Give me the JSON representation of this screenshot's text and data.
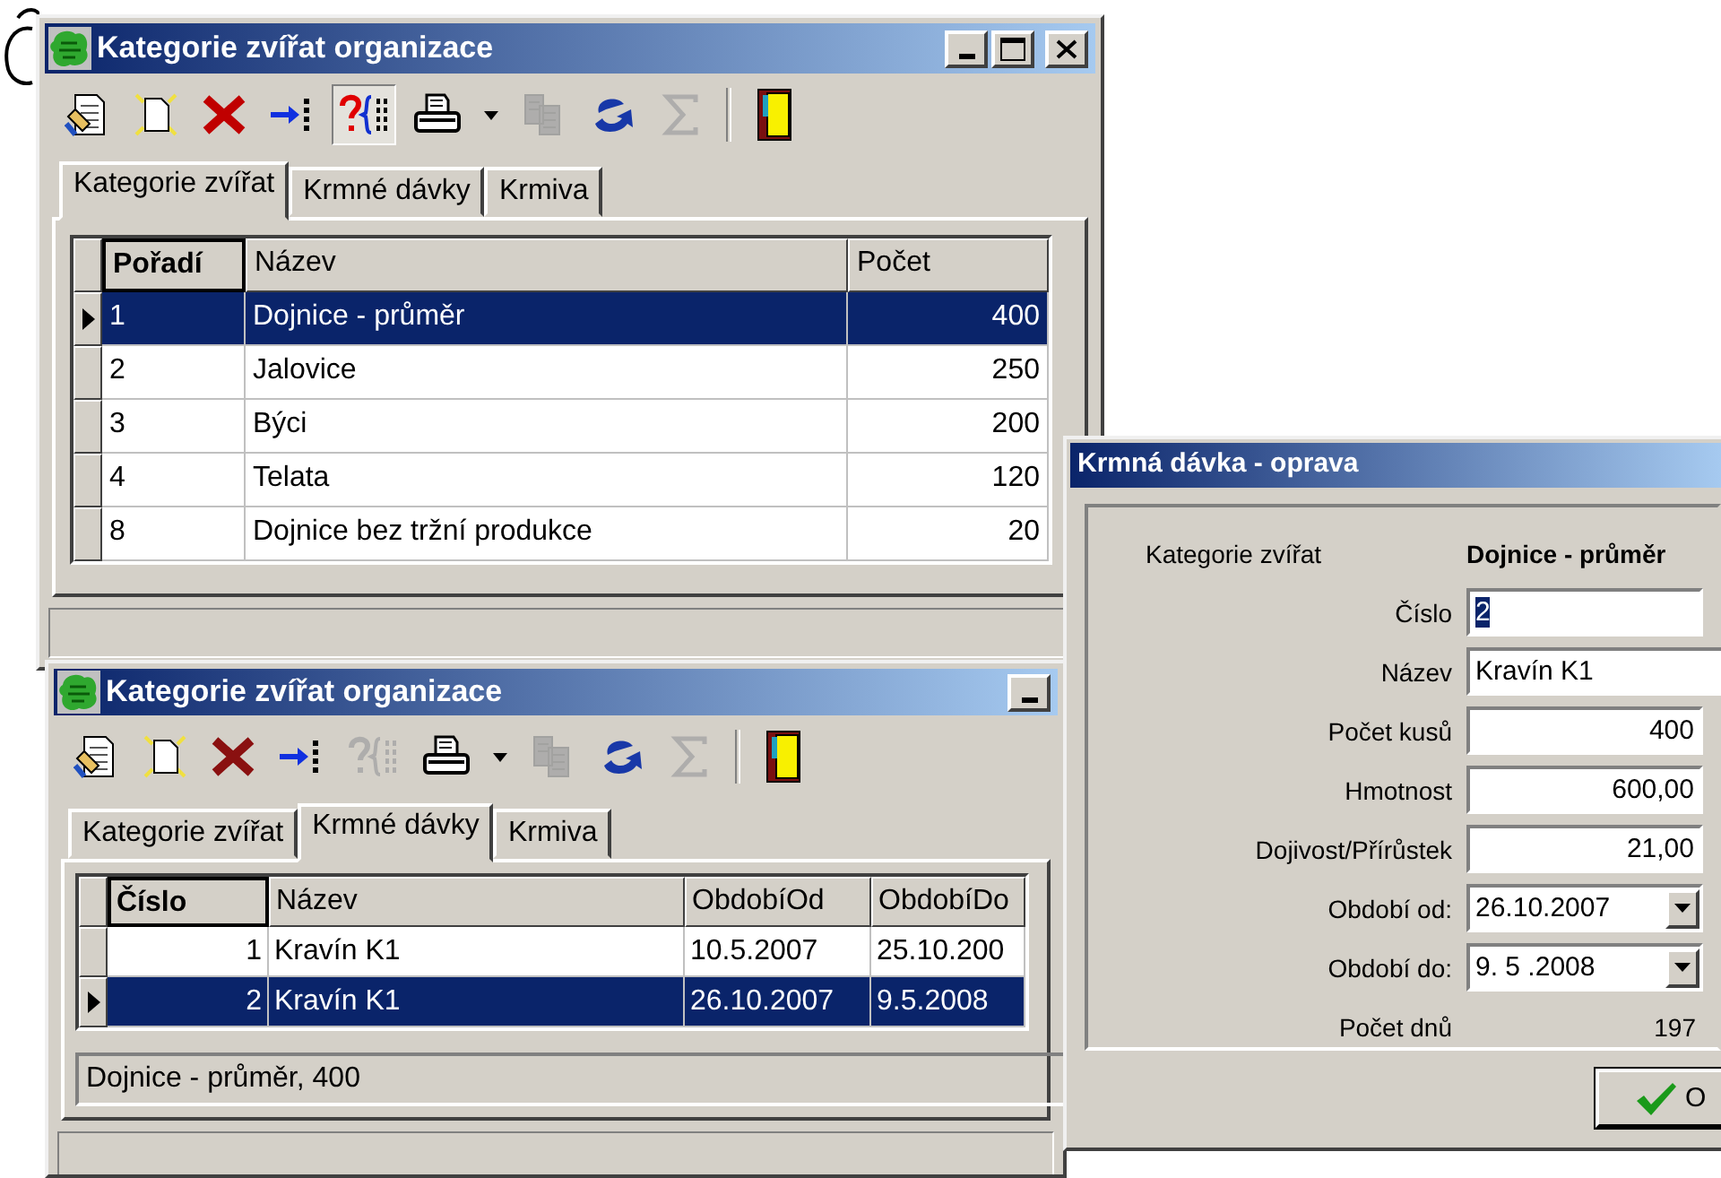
{
  "windows": [
    {
      "title": "Kategorie zvířat organizace",
      "title_buttons": [
        {
          "kind": "minimize"
        },
        {
          "kind": "maximize"
        },
        {
          "kind": "close"
        }
      ],
      "toolbar": [
        {
          "kind": "edit",
          "disabled": false,
          "pressed": false
        },
        {
          "kind": "new",
          "disabled": false,
          "pressed": false
        },
        {
          "kind": "delete",
          "disabled": false,
          "pressed": false
        },
        {
          "kind": "jump",
          "disabled": false,
          "pressed": false
        },
        {
          "kind": "query",
          "disabled": false,
          "pressed": true
        },
        {
          "kind": "print",
          "disabled": false,
          "pressed": false
        },
        {
          "kind": "dropdown",
          "disabled": false,
          "pressed": false
        },
        {
          "kind": "copy",
          "disabled": true,
          "pressed": false
        },
        {
          "kind": "refresh",
          "disabled": false,
          "pressed": false
        },
        {
          "kind": "sum",
          "disabled": true,
          "pressed": false
        },
        {
          "kind": "separator",
          "disabled": false,
          "pressed": false
        },
        {
          "kind": "exit",
          "disabled": false,
          "pressed": false
        }
      ],
      "tabs": [
        {
          "label": "Kategorie zvířat",
          "selected": true
        },
        {
          "label": "Krmné dávky",
          "selected": false
        },
        {
          "label": "Krmiva",
          "selected": false
        }
      ],
      "table": {
        "columns": [
          {
            "label": "Pořadí",
            "sorted": true
          },
          {
            "label": "Název",
            "sorted": false
          },
          {
            "label": "Počet",
            "sorted": false
          }
        ],
        "rows": [
          {
            "cells": [
              "1",
              "Dojnice - průměr",
              "400"
            ],
            "selected": true
          },
          {
            "cells": [
              "2",
              "Jalovice",
              "250"
            ],
            "selected": false
          },
          {
            "cells": [
              "3",
              "Býci",
              "200"
            ],
            "selected": false
          },
          {
            "cells": [
              "4",
              "Telata",
              "120"
            ],
            "selected": false
          },
          {
            "cells": [
              "8",
              "Dojnice bez tržní produkce",
              "20"
            ],
            "selected": false
          }
        ]
      }
    },
    {
      "title": "Kategorie zvířat organizace",
      "title_buttons": [
        {
          "kind": "minimize"
        }
      ],
      "toolbar": [
        {
          "kind": "edit",
          "disabled": false,
          "pressed": false
        },
        {
          "kind": "new",
          "disabled": false,
          "pressed": false
        },
        {
          "kind": "delete",
          "disabled": false,
          "pressed": false
        },
        {
          "kind": "jump",
          "disabled": false,
          "pressed": false
        },
        {
          "kind": "query",
          "disabled": true,
          "pressed": false
        },
        {
          "kind": "print",
          "disabled": false,
          "pressed": false
        },
        {
          "kind": "dropdown",
          "disabled": false,
          "pressed": false
        },
        {
          "kind": "copy",
          "disabled": true,
          "pressed": false
        },
        {
          "kind": "refresh",
          "disabled": false,
          "pressed": false
        },
        {
          "kind": "sum",
          "disabled": true,
          "pressed": false
        },
        {
          "kind": "separator",
          "disabled": false,
          "pressed": false
        },
        {
          "kind": "exit",
          "disabled": false,
          "pressed": false
        }
      ],
      "tabs": [
        {
          "label": "Kategorie zvířat",
          "selected": false
        },
        {
          "label": "Krmné dávky",
          "selected": true
        },
        {
          "label": "Krmiva",
          "selected": false
        }
      ],
      "table": {
        "columns": [
          {
            "label": "Číslo",
            "sorted": true
          },
          {
            "label": "Název",
            "sorted": false
          },
          {
            "label": "ObdobíOd",
            "sorted": false
          },
          {
            "label": "ObdobíDo",
            "sorted": false
          }
        ],
        "rows": [
          {
            "cells": [
              "1",
              "Kravín K1",
              "10.5.2007",
              "25.10.200"
            ],
            "selected": false
          },
          {
            "cells": [
              "2",
              "Kravín K1",
              "26.10.2007",
              "9.5.2008"
            ],
            "selected": true
          }
        ]
      },
      "info": "Dojnice - průměr, 400"
    }
  ],
  "dialog": {
    "title": "Krmná dávka - oprava",
    "fields": [
      {
        "kind": "caption",
        "label": "Kategorie zvířat",
        "value": "Dojnice - průměr",
        "highlighted": false
      },
      {
        "kind": "text",
        "label": "Číslo",
        "value": "2",
        "highlighted": true
      },
      {
        "kind": "text",
        "label": "Název",
        "value": "Kravín K1",
        "highlighted": false
      },
      {
        "kind": "number",
        "label": "Počet kusů",
        "value": "400",
        "highlighted": false
      },
      {
        "kind": "number",
        "label": "Hmotnost",
        "value": "600,00",
        "highlighted": false
      },
      {
        "kind": "number",
        "label": "Dojivost/Přírůstek",
        "value": "21,00",
        "highlighted": false
      },
      {
        "kind": "date",
        "label": "Období od:",
        "value": "26.10.2007",
        "highlighted": false
      },
      {
        "kind": "date",
        "label": "Období do:",
        "value": "9. 5 .2008",
        "highlighted": false
      },
      {
        "kind": "readout",
        "label": "Počet dnů",
        "value": "197",
        "highlighted": false
      }
    ],
    "ok_button": "O"
  }
}
